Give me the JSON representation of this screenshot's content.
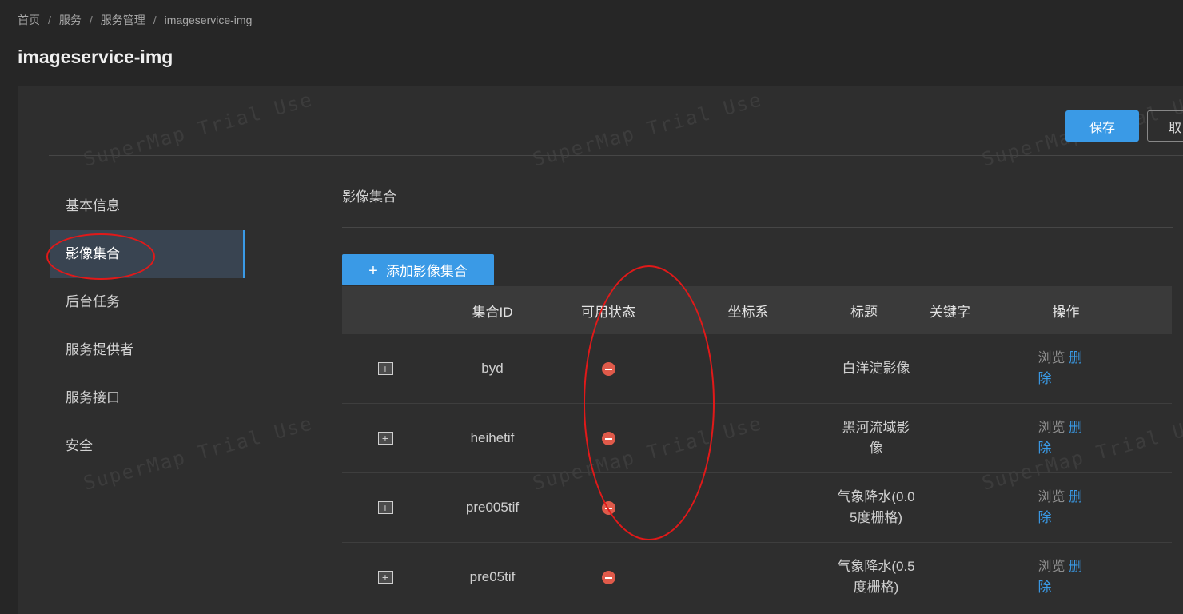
{
  "breadcrumb": [
    "首页",
    "服务",
    "服务管理",
    "imageservice-img"
  ],
  "page_title": "imageservice-img",
  "watermark_text": "SuperMap Trial Use",
  "actions": {
    "save_label": "保存",
    "cancel_label": "取"
  },
  "sidebar": {
    "items": [
      {
        "label": "基本信息",
        "active": false
      },
      {
        "label": "影像集合",
        "active": true
      },
      {
        "label": "后台任务",
        "active": false
      },
      {
        "label": "服务提供者",
        "active": false
      },
      {
        "label": "服务接口",
        "active": false
      },
      {
        "label": "安全",
        "active": false
      }
    ]
  },
  "section": {
    "title": "影像集合",
    "add_button_label": "添加影像集合"
  },
  "table": {
    "columns": [
      "",
      "集合ID",
      "可用状态",
      "坐标系",
      "标题",
      "关键字",
      "操作"
    ],
    "rows": [
      {
        "id": "byd",
        "status": "unavailable",
        "crs": "",
        "title": "白洋淀影像",
        "keywords": ""
      },
      {
        "id": "heihetif",
        "status": "unavailable",
        "crs": "",
        "title": "黑河流域影像",
        "keywords": ""
      },
      {
        "id": "pre005tif",
        "status": "unavailable",
        "crs": "",
        "title": "气象降水(0.05度栅格)",
        "keywords": ""
      },
      {
        "id": "pre05tif",
        "status": "unavailable",
        "crs": "",
        "title": "气象降水(0.5度栅格)",
        "keywords": ""
      }
    ],
    "row_actions": {
      "expand_symbol": "+",
      "browse_label": "浏览",
      "delete_label": "删除"
    }
  },
  "colors": {
    "accent": "#3a9ae6",
    "status_unavailable": "#e05a4a",
    "annotation": "#e11919",
    "background": "#262626",
    "panel": "#2e2e2e"
  }
}
